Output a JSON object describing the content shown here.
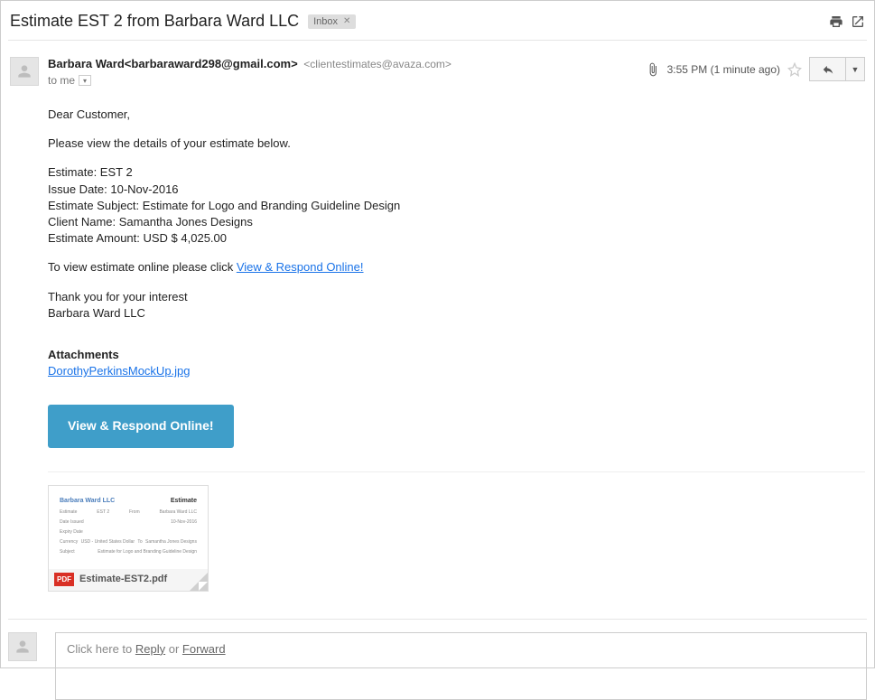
{
  "header": {
    "subject": "Estimate EST 2 from Barbara Ward LLC",
    "tag": "Inbox"
  },
  "meta": {
    "sender_name": "Barbara Ward",
    "sender_email": "<barbaraward298@gmail.com>",
    "reply_to": "<clientestimates@avaza.com>",
    "to_line": "to me",
    "time": "3:55 PM (1 minute ago)"
  },
  "body": {
    "greeting": "Dear Customer,",
    "intro": "Please view the details of your estimate below.",
    "fields": {
      "estimate": "Estimate: EST 2",
      "issue_date": "Issue Date: 10-Nov-2016",
      "subject": "Estimate Subject: Estimate for Logo and Branding Guideline Design",
      "client": "Client Name: Samantha Jones Designs",
      "amount": "Estimate Amount: USD $ 4,025.00"
    },
    "view_prefix": "To view estimate online please click ",
    "view_link": "View & Respond Online!",
    "thanks": "Thank you for your interest",
    "signoff": "Barbara Ward LLC",
    "attach_heading": "Attachments",
    "attach_file": "DorothyPerkinsMockUp.jpg",
    "cta": "View & Respond Online!"
  },
  "attachment": {
    "filename": "Estimate-EST2.pdf",
    "badge": "PDF",
    "preview": {
      "company": "Barbara Ward LLC",
      "doc_label": "Estimate"
    }
  },
  "reply": {
    "prefix": "Click here to ",
    "reply_label": "Reply",
    "middle": " or ",
    "forward_label": "Forward"
  }
}
